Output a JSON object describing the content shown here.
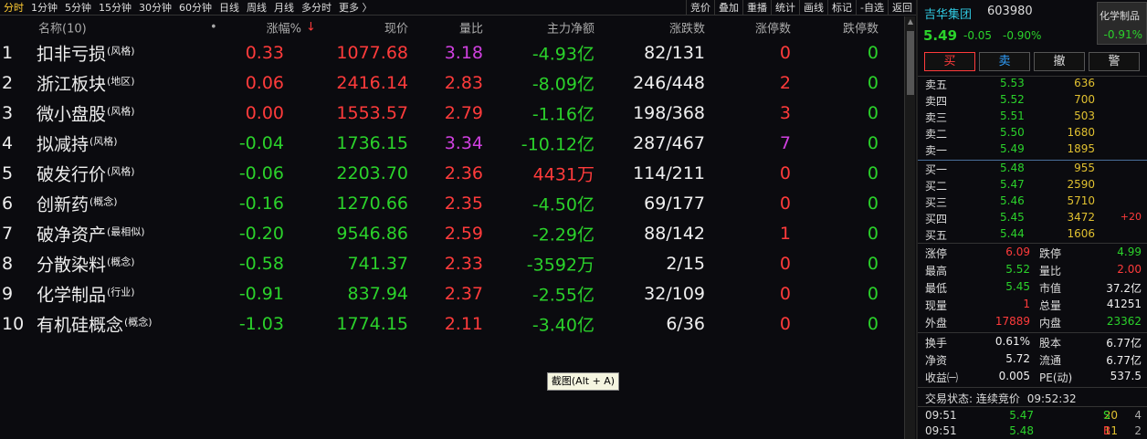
{
  "toolbar": {
    "periods": [
      "分时",
      "1分钟",
      "5分钟",
      "15分钟",
      "30分钟",
      "60分钟",
      "日线",
      "周线",
      "月线",
      "多分时",
      "更多 〉"
    ],
    "active_period": 0,
    "tools": [
      "竞价",
      "叠加",
      "重播",
      "统计",
      "画线",
      "标记",
      "-自选",
      "返回"
    ]
  },
  "table": {
    "headers": {
      "name": "名称(10)",
      "dot": "•",
      "chg": "涨幅%",
      "sort_arrow": "↓",
      "price": "现价",
      "vr": "量比",
      "flow": "主力净额",
      "updown": "涨跌数",
      "lu": "涨停数",
      "ld": "跌停数"
    },
    "rows": [
      {
        "idx": "1",
        "name": "扣非亏损",
        "tag": "(风格)",
        "chg": "0.33",
        "price": "1077.68",
        "vr": "3.18",
        "flow": "-4.93亿",
        "updown": "82/131",
        "lu": "0",
        "ld": "0",
        "chg_c": "red",
        "price_c": "red",
        "vr_c": "purple",
        "flow_c": "green",
        "lu_c": "red"
      },
      {
        "idx": "2",
        "name": "浙江板块",
        "tag": "(地区)",
        "chg": "0.06",
        "price": "2416.14",
        "vr": "2.83",
        "flow": "-8.09亿",
        "updown": "246/448",
        "lu": "2",
        "ld": "0",
        "chg_c": "red",
        "price_c": "red",
        "vr_c": "red",
        "flow_c": "green",
        "lu_c": "red"
      },
      {
        "idx": "3",
        "name": "微小盘股",
        "tag": "(风格)",
        "chg": "0.00",
        "price": "1553.57",
        "vr": "2.79",
        "flow": "-1.16亿",
        "updown": "198/368",
        "lu": "3",
        "ld": "0",
        "chg_c": "red",
        "price_c": "red",
        "vr_c": "red",
        "flow_c": "green",
        "lu_c": "red"
      },
      {
        "idx": "4",
        "name": "拟减持",
        "tag": "(风格)",
        "chg": "-0.04",
        "price": "1736.15",
        "vr": "3.34",
        "flow": "-10.12亿",
        "updown": "287/467",
        "lu": "7",
        "ld": "0",
        "chg_c": "green",
        "price_c": "green",
        "vr_c": "purple",
        "flow_c": "green",
        "lu_c": "purple"
      },
      {
        "idx": "5",
        "name": "破发行价",
        "tag": "(风格)",
        "chg": "-0.06",
        "price": "2203.70",
        "vr": "2.36",
        "flow": "4431万",
        "updown": "114/211",
        "lu": "0",
        "ld": "0",
        "chg_c": "green",
        "price_c": "green",
        "vr_c": "red",
        "flow_c": "red",
        "lu_c": "red"
      },
      {
        "idx": "6",
        "name": "创新药",
        "tag": "(概念)",
        "chg": "-0.16",
        "price": "1270.66",
        "vr": "2.35",
        "flow": "-4.50亿",
        "updown": "69/177",
        "lu": "0",
        "ld": "0",
        "chg_c": "green",
        "price_c": "green",
        "vr_c": "red",
        "flow_c": "green",
        "lu_c": "red"
      },
      {
        "idx": "7",
        "name": "破净资产",
        "tag": "(最相似)",
        "chg": "-0.20",
        "price": "9546.86",
        "vr": "2.59",
        "flow": "-2.29亿",
        "updown": "88/142",
        "lu": "1",
        "ld": "0",
        "chg_c": "green",
        "price_c": "green",
        "vr_c": "red",
        "flow_c": "green",
        "lu_c": "red"
      },
      {
        "idx": "8",
        "name": "分散染料",
        "tag": "(概念)",
        "chg": "-0.58",
        "price": "741.37",
        "vr": "2.33",
        "flow": "-3592万",
        "updown": "2/15",
        "lu": "0",
        "ld": "0",
        "chg_c": "green",
        "price_c": "green",
        "vr_c": "red",
        "flow_c": "green",
        "lu_c": "red"
      },
      {
        "idx": "9",
        "name": "化学制品",
        "tag": "(行业)",
        "chg": "-0.91",
        "price": "837.94",
        "vr": "2.37",
        "flow": "-2.55亿",
        "updown": "32/109",
        "lu": "0",
        "ld": "0",
        "chg_c": "green",
        "price_c": "green",
        "vr_c": "red",
        "flow_c": "green",
        "lu_c": "red"
      },
      {
        "idx": "10",
        "name": "有机硅概念",
        "tag": "(概念)",
        "chg": "-1.03",
        "price": "1774.15",
        "vr": "2.11",
        "flow": "-3.40亿",
        "updown": "6/36",
        "lu": "0",
        "ld": "0",
        "chg_c": "green",
        "price_c": "green",
        "vr_c": "red",
        "flow_c": "green",
        "lu_c": "red"
      }
    ]
  },
  "stock": {
    "name": "吉华集团",
    "code": "603980",
    "sector": "化学制品",
    "sector_chg": "-0.91%",
    "price": "5.49",
    "chg": "-0.05",
    "pct": "-0.90%"
  },
  "buttons": {
    "buy": "买",
    "sell": "卖",
    "cancel": "撤",
    "alert": "警"
  },
  "sell_book": [
    {
      "label": "卖五",
      "price": "5.53",
      "vol": "636"
    },
    {
      "label": "卖四",
      "price": "5.52",
      "vol": "700"
    },
    {
      "label": "卖三",
      "price": "5.51",
      "vol": "503"
    },
    {
      "label": "卖二",
      "price": "5.50",
      "vol": "1680"
    },
    {
      "label": "卖一",
      "price": "5.49",
      "vol": "1895"
    }
  ],
  "buy_book": [
    {
      "label": "买一",
      "price": "5.48",
      "vol": "955",
      "delta": ""
    },
    {
      "label": "买二",
      "price": "5.47",
      "vol": "2590",
      "delta": ""
    },
    {
      "label": "买三",
      "price": "5.46",
      "vol": "5710",
      "delta": ""
    },
    {
      "label": "买四",
      "price": "5.45",
      "vol": "3472",
      "delta": "+20"
    },
    {
      "label": "买五",
      "price": "5.44",
      "vol": "1606",
      "delta": ""
    }
  ],
  "stats1": [
    {
      "k1": "涨停",
      "v1": "6.09",
      "c1": "red",
      "k2": "跌停",
      "v2": "4.99",
      "c2": "green"
    },
    {
      "k1": "最高",
      "v1": "5.52",
      "c1": "green",
      "k2": "量比",
      "v2": "2.00",
      "c2": "red"
    },
    {
      "k1": "最低",
      "v1": "5.45",
      "c1": "green",
      "k2": "市值",
      "v2": "37.2亿",
      "c2": "white"
    },
    {
      "k1": "现量",
      "v1": "1",
      "c1": "red",
      "k2": "总量",
      "v2": "41251",
      "c2": "white"
    },
    {
      "k1": "外盘",
      "v1": "17889",
      "c1": "red",
      "k2": "内盘",
      "v2": "23362",
      "c2": "green"
    }
  ],
  "stats2": [
    {
      "k1": "换手",
      "v1": "0.61%",
      "c1": "white",
      "k2": "股本",
      "v2": "6.77亿",
      "c2": "white"
    },
    {
      "k1": "净资",
      "v1": "5.72",
      "c1": "white",
      "k2": "流通",
      "v2": "6.77亿",
      "c2": "white"
    },
    {
      "k1": "收益㈠",
      "v1": "0.005",
      "c1": "white",
      "k2": "PE(动)",
      "v2": "537.5",
      "c2": "white"
    }
  ],
  "status": {
    "label": "交易状态: 连续竞价",
    "time": "09:52:32"
  },
  "ticks": [
    {
      "time": "09:51",
      "price": "5.47",
      "vol": "20",
      "side": "S",
      "n": "4"
    },
    {
      "time": "09:51",
      "price": "5.48",
      "vol": "11",
      "side": "B",
      "n": "2"
    }
  ],
  "tooltip": "截图(Alt + A)"
}
